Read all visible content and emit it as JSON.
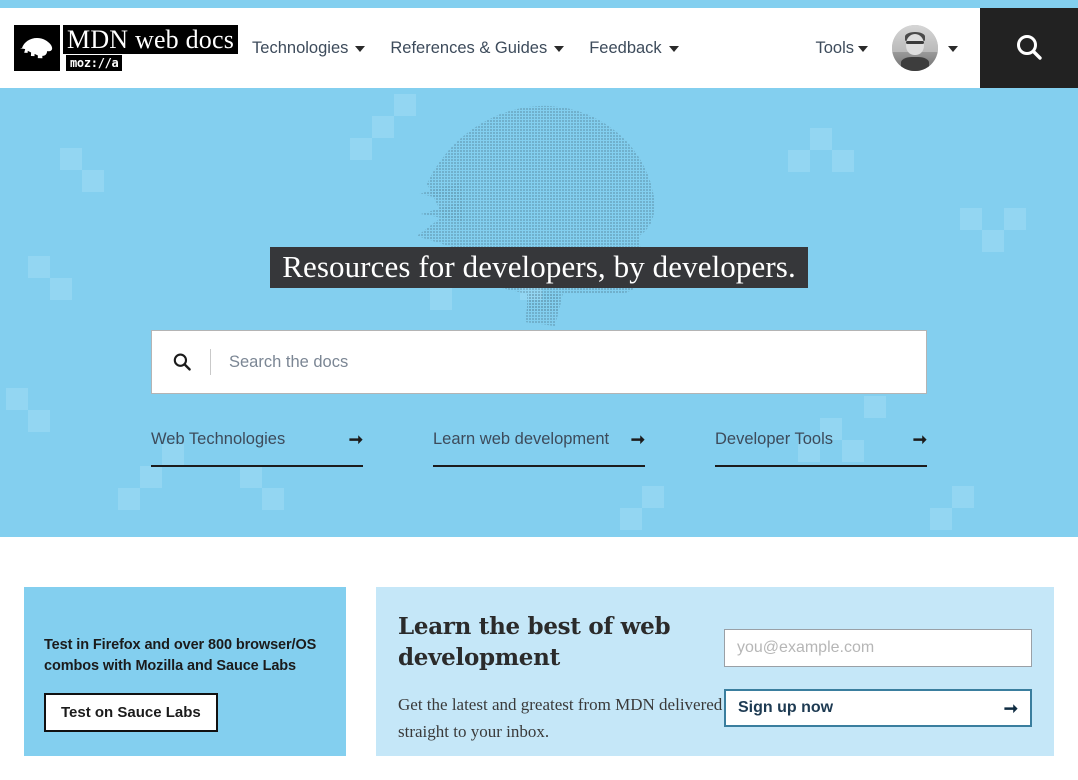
{
  "theme": {
    "hero_blue": "#83cfef",
    "newsletter_blue": "#c5e7f8",
    "dark": "#222222",
    "nav_text": "#3d4b5b",
    "tagline_bg": "#36373a"
  },
  "header": {
    "logo": {
      "icon": "mdn-dino-icon",
      "title": "MDN web docs",
      "sub": "moz://a"
    },
    "nav": [
      {
        "label": "Technologies",
        "icon": "chevron-down-icon"
      },
      {
        "label": "References & Guides",
        "icon": "chevron-down-icon"
      },
      {
        "label": "Feedback",
        "icon": "chevron-down-icon"
      }
    ],
    "tools": {
      "label": "Tools",
      "icon": "chevron-down-icon"
    },
    "account": {
      "icon": "avatar",
      "caret": "chevron-down-icon"
    },
    "search_button": {
      "icon": "search-icon"
    }
  },
  "hero": {
    "mascot_icon": "halftone-dino-head-icon",
    "tagline": "Resources for developers, by developers.",
    "search": {
      "icon": "search-icon",
      "value": "",
      "placeholder": "Search the docs"
    },
    "quick_links": [
      {
        "label": "Web Technologies",
        "icon": "arrow-right-icon"
      },
      {
        "label": "Learn web development",
        "icon": "arrow-right-icon"
      },
      {
        "label": "Developer Tools",
        "icon": "arrow-right-icon"
      }
    ]
  },
  "sauce_labs": {
    "text": "Test in Firefox and over 800 browser/OS combos with Mozilla and Sauce Labs",
    "button_label": "Test on Sauce Labs"
  },
  "newsletter": {
    "title": "Learn the best of web development",
    "subtitle": "Get the latest and greatest from MDN delivered straight to your inbox.",
    "email": {
      "value": "",
      "placeholder": "you@example.com"
    },
    "submit_label": "Sign up now",
    "submit_icon": "arrow-right-icon"
  }
}
